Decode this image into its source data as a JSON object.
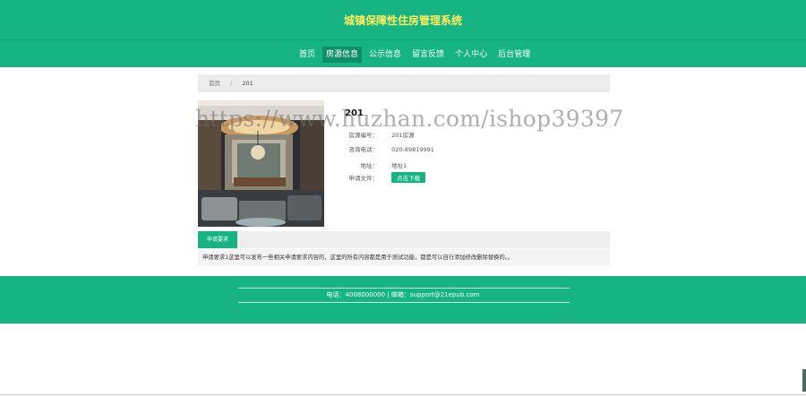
{
  "header": {
    "title": "城镇保障性住房管理系统"
  },
  "nav": {
    "items": [
      "首页",
      "房源信息",
      "公示信息",
      "留言反馈",
      "个人中心",
      "后台管理"
    ],
    "active_index": 1
  },
  "breadcrumb": {
    "home": "首页",
    "separator": "/",
    "current": "201"
  },
  "house": {
    "name": "201",
    "rows": [
      {
        "label": "房源编号：",
        "value": "201房源"
      },
      {
        "label": "咨询电话：",
        "value": "020-89819991"
      },
      {
        "label": "地址：",
        "value": "地址1"
      },
      {
        "label": "申请文件：",
        "button": "点击下载"
      }
    ]
  },
  "watermark": "https://www.huzhan.com/ishop39397",
  "tabs": {
    "requirements": "申请要求"
  },
  "requirements_text": "申请要求1这里可以发布一些相关申请要求内容的，这里的所有内容都是用于测试功能，都是可以自行添加修改删除替换的。。",
  "footer": {
    "contact": "电话：4008000000 | 邮箱：support@21epub.com"
  },
  "colors": {
    "primary": "#16b383",
    "title_yellow": "#ffef5c",
    "active_nav": "#0f8f67"
  }
}
